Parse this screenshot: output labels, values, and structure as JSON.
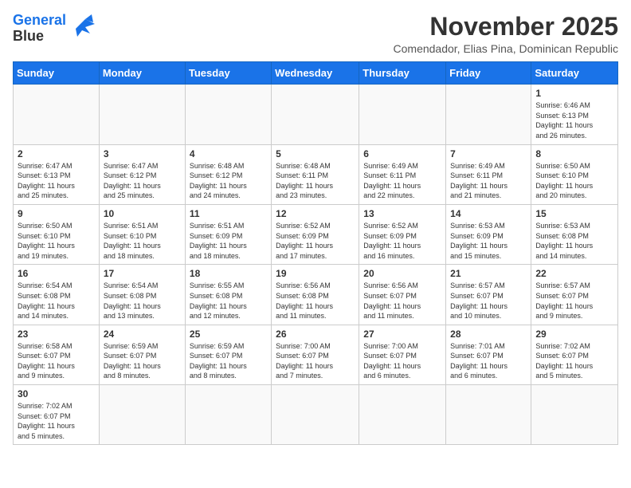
{
  "header": {
    "logo_line1": "General",
    "logo_line2": "Blue",
    "month": "November 2025",
    "location": "Comendador, Elias Pina, Dominican Republic"
  },
  "weekdays": [
    "Sunday",
    "Monday",
    "Tuesday",
    "Wednesday",
    "Thursday",
    "Friday",
    "Saturday"
  ],
  "weeks": [
    [
      {
        "day": "",
        "info": ""
      },
      {
        "day": "",
        "info": ""
      },
      {
        "day": "",
        "info": ""
      },
      {
        "day": "",
        "info": ""
      },
      {
        "day": "",
        "info": ""
      },
      {
        "day": "",
        "info": ""
      },
      {
        "day": "1",
        "info": "Sunrise: 6:46 AM\nSunset: 6:13 PM\nDaylight: 11 hours\nand 26 minutes."
      }
    ],
    [
      {
        "day": "2",
        "info": "Sunrise: 6:47 AM\nSunset: 6:13 PM\nDaylight: 11 hours\nand 25 minutes."
      },
      {
        "day": "3",
        "info": "Sunrise: 6:47 AM\nSunset: 6:12 PM\nDaylight: 11 hours\nand 25 minutes."
      },
      {
        "day": "4",
        "info": "Sunrise: 6:48 AM\nSunset: 6:12 PM\nDaylight: 11 hours\nand 24 minutes."
      },
      {
        "day": "5",
        "info": "Sunrise: 6:48 AM\nSunset: 6:11 PM\nDaylight: 11 hours\nand 23 minutes."
      },
      {
        "day": "6",
        "info": "Sunrise: 6:49 AM\nSunset: 6:11 PM\nDaylight: 11 hours\nand 22 minutes."
      },
      {
        "day": "7",
        "info": "Sunrise: 6:49 AM\nSunset: 6:11 PM\nDaylight: 11 hours\nand 21 minutes."
      },
      {
        "day": "8",
        "info": "Sunrise: 6:50 AM\nSunset: 6:10 PM\nDaylight: 11 hours\nand 20 minutes."
      }
    ],
    [
      {
        "day": "9",
        "info": "Sunrise: 6:50 AM\nSunset: 6:10 PM\nDaylight: 11 hours\nand 19 minutes."
      },
      {
        "day": "10",
        "info": "Sunrise: 6:51 AM\nSunset: 6:10 PM\nDaylight: 11 hours\nand 18 minutes."
      },
      {
        "day": "11",
        "info": "Sunrise: 6:51 AM\nSunset: 6:09 PM\nDaylight: 11 hours\nand 18 minutes."
      },
      {
        "day": "12",
        "info": "Sunrise: 6:52 AM\nSunset: 6:09 PM\nDaylight: 11 hours\nand 17 minutes."
      },
      {
        "day": "13",
        "info": "Sunrise: 6:52 AM\nSunset: 6:09 PM\nDaylight: 11 hours\nand 16 minutes."
      },
      {
        "day": "14",
        "info": "Sunrise: 6:53 AM\nSunset: 6:09 PM\nDaylight: 11 hours\nand 15 minutes."
      },
      {
        "day": "15",
        "info": "Sunrise: 6:53 AM\nSunset: 6:08 PM\nDaylight: 11 hours\nand 14 minutes."
      }
    ],
    [
      {
        "day": "16",
        "info": "Sunrise: 6:54 AM\nSunset: 6:08 PM\nDaylight: 11 hours\nand 14 minutes."
      },
      {
        "day": "17",
        "info": "Sunrise: 6:54 AM\nSunset: 6:08 PM\nDaylight: 11 hours\nand 13 minutes."
      },
      {
        "day": "18",
        "info": "Sunrise: 6:55 AM\nSunset: 6:08 PM\nDaylight: 11 hours\nand 12 minutes."
      },
      {
        "day": "19",
        "info": "Sunrise: 6:56 AM\nSunset: 6:08 PM\nDaylight: 11 hours\nand 11 minutes."
      },
      {
        "day": "20",
        "info": "Sunrise: 6:56 AM\nSunset: 6:07 PM\nDaylight: 11 hours\nand 11 minutes."
      },
      {
        "day": "21",
        "info": "Sunrise: 6:57 AM\nSunset: 6:07 PM\nDaylight: 11 hours\nand 10 minutes."
      },
      {
        "day": "22",
        "info": "Sunrise: 6:57 AM\nSunset: 6:07 PM\nDaylight: 11 hours\nand 9 minutes."
      }
    ],
    [
      {
        "day": "23",
        "info": "Sunrise: 6:58 AM\nSunset: 6:07 PM\nDaylight: 11 hours\nand 9 minutes."
      },
      {
        "day": "24",
        "info": "Sunrise: 6:59 AM\nSunset: 6:07 PM\nDaylight: 11 hours\nand 8 minutes."
      },
      {
        "day": "25",
        "info": "Sunrise: 6:59 AM\nSunset: 6:07 PM\nDaylight: 11 hours\nand 8 minutes."
      },
      {
        "day": "26",
        "info": "Sunrise: 7:00 AM\nSunset: 6:07 PM\nDaylight: 11 hours\nand 7 minutes."
      },
      {
        "day": "27",
        "info": "Sunrise: 7:00 AM\nSunset: 6:07 PM\nDaylight: 11 hours\nand 6 minutes."
      },
      {
        "day": "28",
        "info": "Sunrise: 7:01 AM\nSunset: 6:07 PM\nDaylight: 11 hours\nand 6 minutes."
      },
      {
        "day": "29",
        "info": "Sunrise: 7:02 AM\nSunset: 6:07 PM\nDaylight: 11 hours\nand 5 minutes."
      }
    ],
    [
      {
        "day": "30",
        "info": "Sunrise: 7:02 AM\nSunset: 6:07 PM\nDaylight: 11 hours\nand 5 minutes."
      },
      {
        "day": "",
        "info": ""
      },
      {
        "day": "",
        "info": ""
      },
      {
        "day": "",
        "info": ""
      },
      {
        "day": "",
        "info": ""
      },
      {
        "day": "",
        "info": ""
      },
      {
        "day": "",
        "info": ""
      }
    ]
  ]
}
